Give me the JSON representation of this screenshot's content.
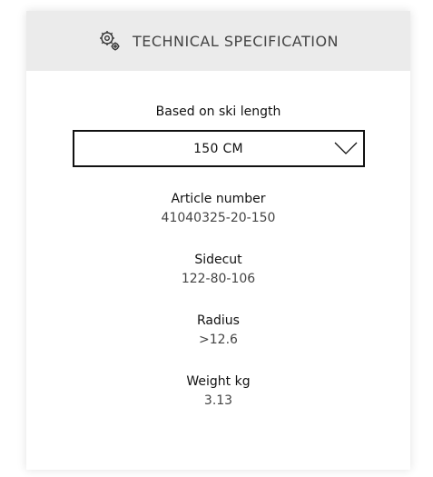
{
  "header": {
    "icon": "gears-icon",
    "title": "TECHNICAL SPECIFICATION"
  },
  "length_selector": {
    "label": "Based on ski length",
    "selected": "150 CM",
    "icon": "chevron-down-icon"
  },
  "specs": [
    {
      "label": "Article number",
      "value": "41040325-20-150"
    },
    {
      "label": "Sidecut",
      "value": "122-80-106"
    },
    {
      "label": "Radius",
      "value": ">12.6"
    },
    {
      "label": "Weight kg",
      "value": "3.13"
    }
  ]
}
